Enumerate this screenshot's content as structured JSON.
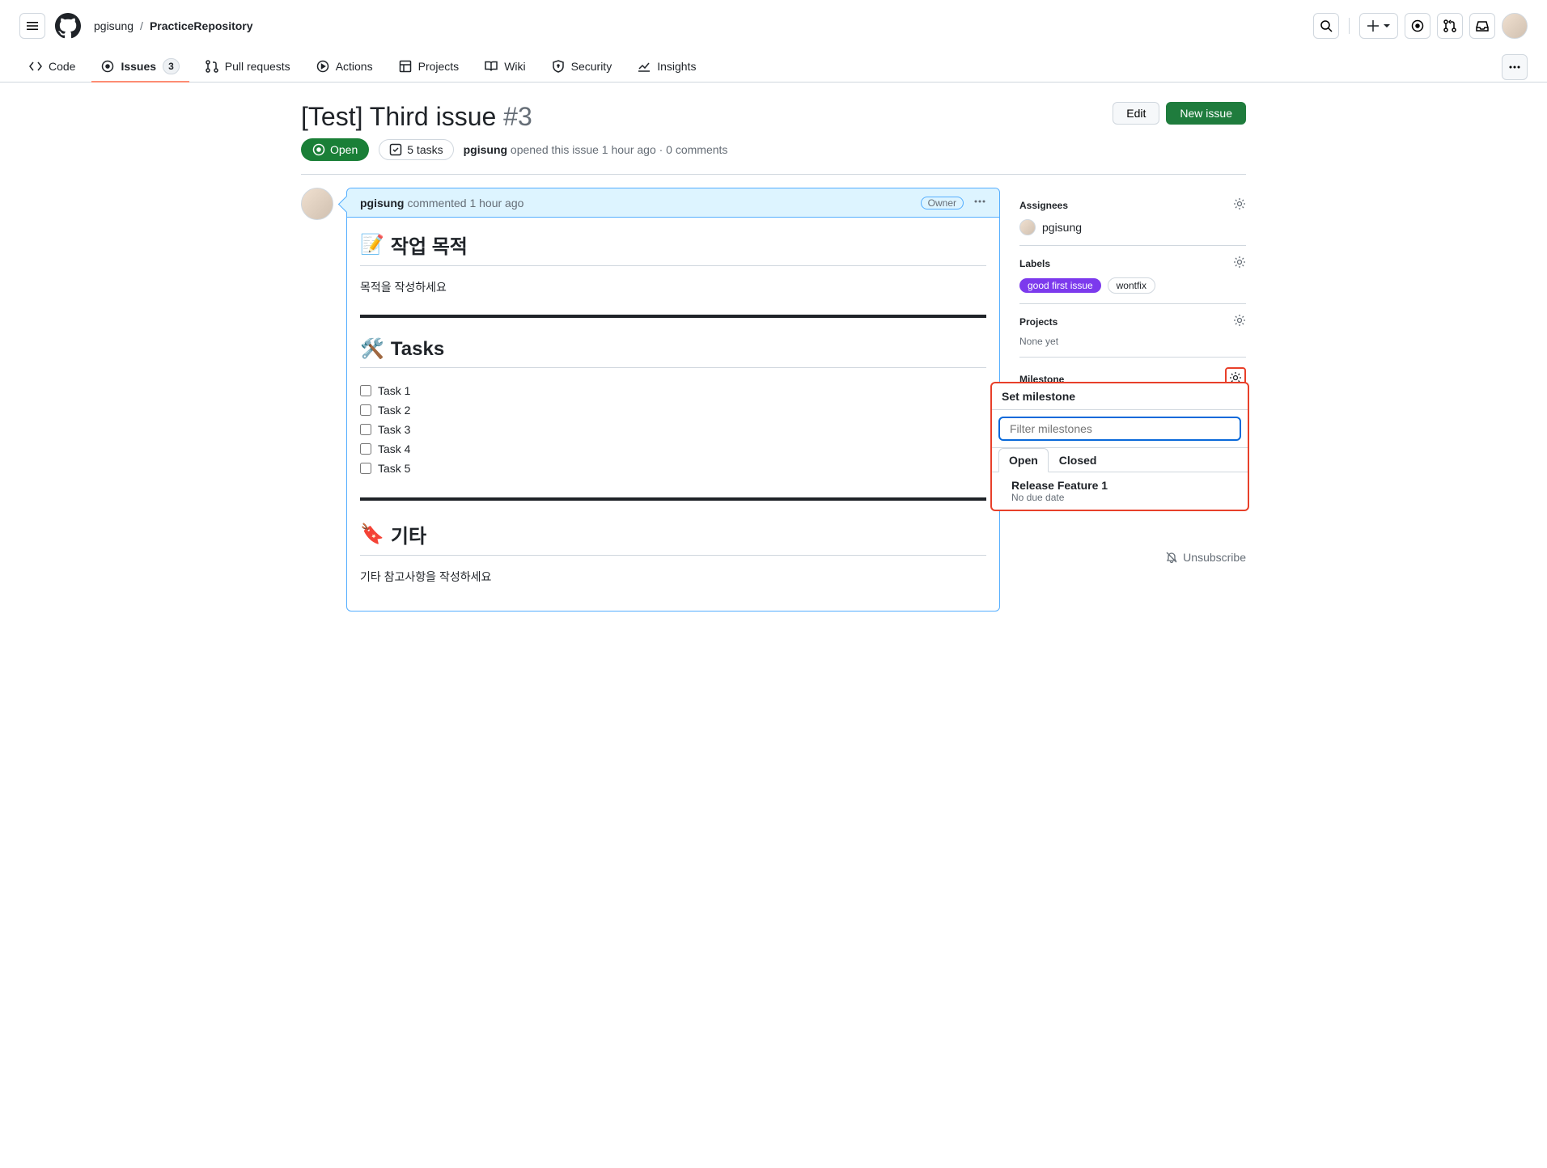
{
  "breadcrumb": {
    "owner": "pgisung",
    "sep": "/",
    "repo": "PracticeRepository"
  },
  "tabs": {
    "code": "Code",
    "issues": "Issues",
    "issues_count": "3",
    "pulls": "Pull requests",
    "actions": "Actions",
    "projects": "Projects",
    "wiki": "Wiki",
    "security": "Security",
    "insights": "Insights"
  },
  "issue": {
    "title": "[Test] Third issue ",
    "number": "#3",
    "state": "Open",
    "tasks_badge": "5 tasks",
    "opener": "pgisung",
    "opened_text": " opened this issue 1 hour ago · 0 comments",
    "edit_btn": "Edit",
    "new_btn": "New issue"
  },
  "comment": {
    "author": "pgisung",
    "time": " commented 1 hour ago",
    "owner_badge": "Owner",
    "h_goal": "작업 목적",
    "p_goal": "목적을 작성하세요",
    "h_tasks": "Tasks",
    "tasks": [
      "Task 1",
      "Task 2",
      "Task 3",
      "Task 4",
      "Task 5"
    ],
    "h_etc": "기타",
    "p_etc": "기타 참고사항을 작성하세요"
  },
  "sidebar": {
    "assignees_h": "Assignees",
    "assignee": "pgisung",
    "labels_h": "Labels",
    "label1": "good first issue",
    "label2": "wontfix",
    "projects_h": "Projects",
    "projects_none": "None yet",
    "milestone_h": "Milestone",
    "unsubscribe": "Unsubscribe"
  },
  "popover": {
    "title": "Set milestone",
    "filter_placeholder": "Filter milestones",
    "tab_open": "Open",
    "tab_closed": "Closed",
    "item_title": "Release Feature 1",
    "item_sub": "No due date"
  }
}
